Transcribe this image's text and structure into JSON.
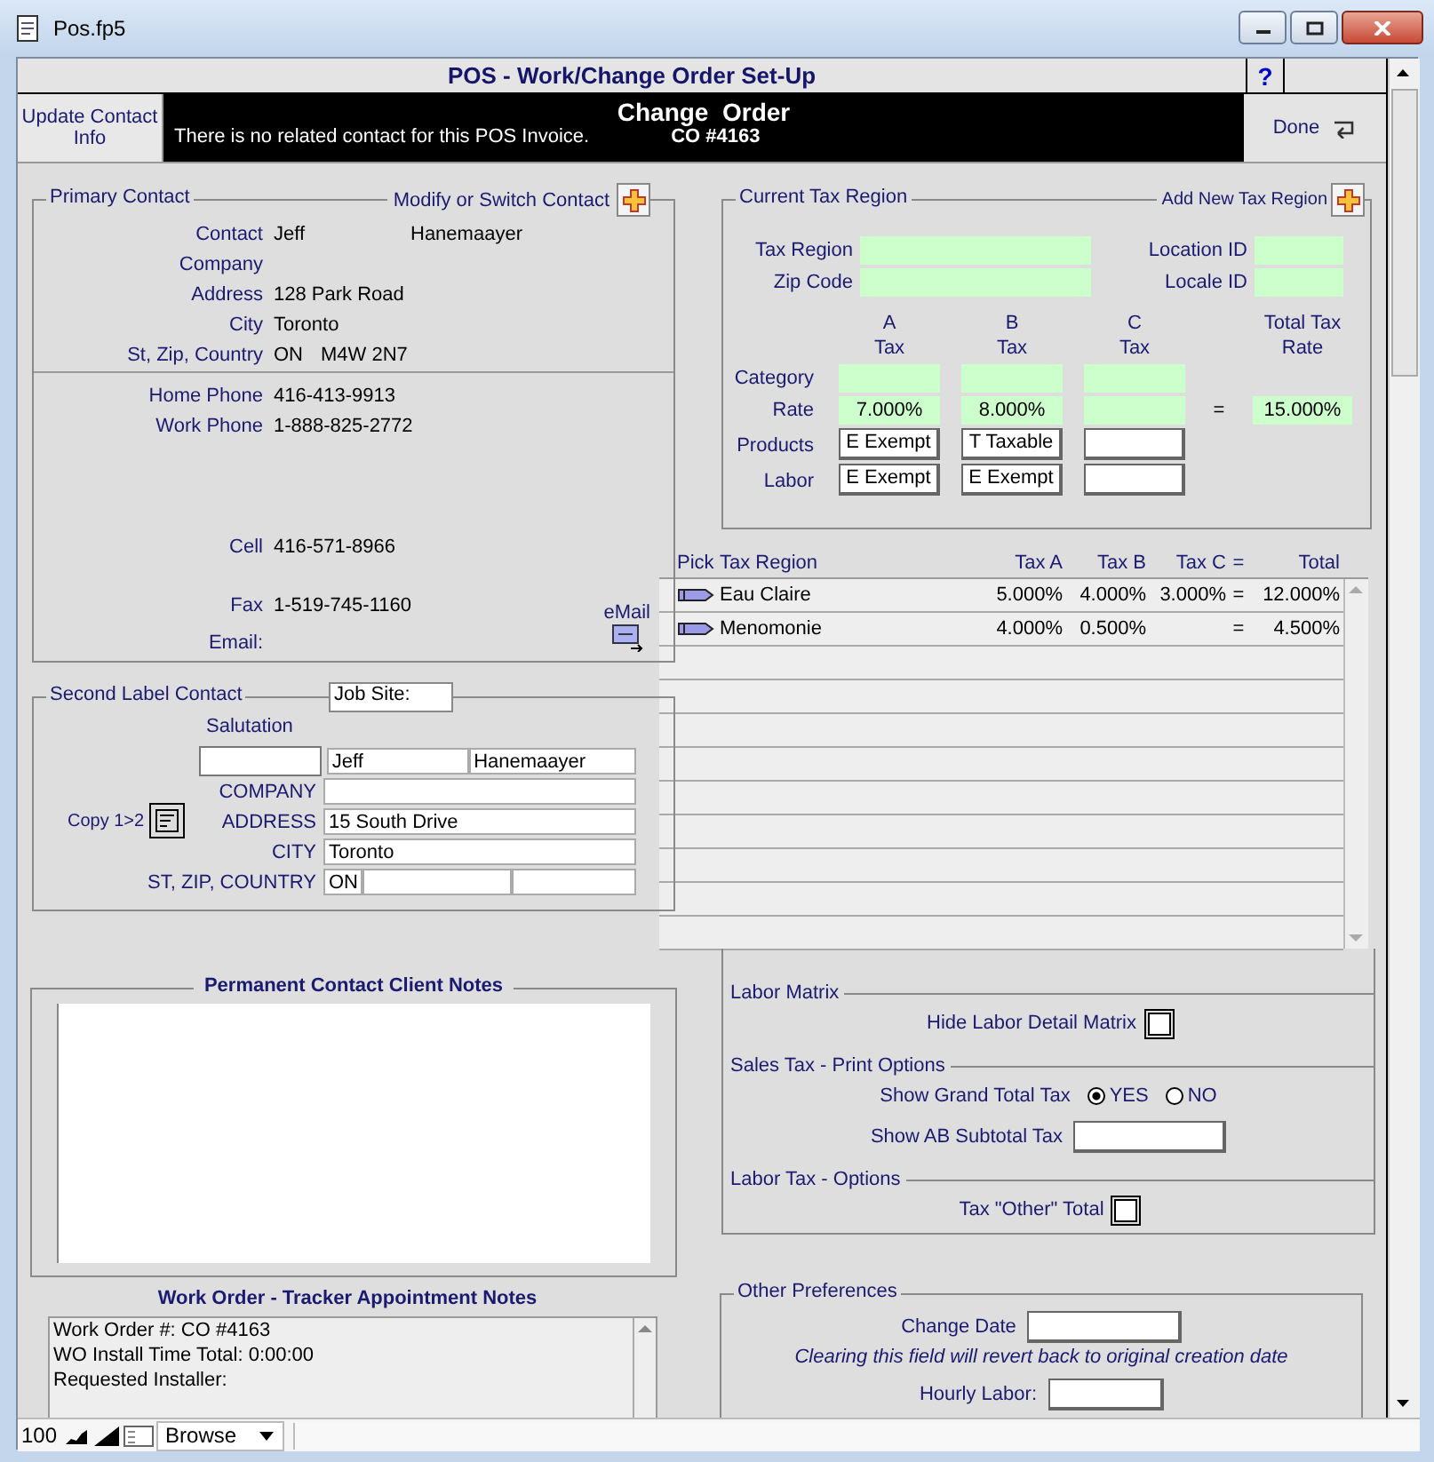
{
  "window": {
    "title": "Pos.fp5"
  },
  "header": {
    "title": "POS - Work/Change Order Set-Up",
    "help": "?",
    "update_button": "Update Contact Info",
    "heading": "Change  Order",
    "message": "There is no related contact for this POS Invoice.",
    "order_number": "CO #4163",
    "done_button": "Done"
  },
  "primary_contact": {
    "title": "Primary Contact",
    "modify_label": "Modify or Switch Contact",
    "fields": [
      {
        "label": "Contact",
        "values": [
          "Jeff",
          "Hanemaayer"
        ]
      },
      {
        "label": "Company"
      },
      {
        "label": "Address",
        "values": [
          "128 Park Road"
        ]
      },
      {
        "label": "City",
        "values": [
          "Toronto"
        ]
      },
      {
        "label": "St, Zip, Country",
        "values": [
          "ON",
          "M4W 2N7"
        ]
      }
    ],
    "phones": [
      {
        "label": "Home Phone",
        "value": "416-413-9913"
      },
      {
        "label": "Work Phone",
        "value": "1-888-825-2772"
      },
      {
        "label": "Cell",
        "value": "416-571-8966"
      },
      {
        "label": "Fax",
        "value": "1-519-745-1160"
      },
      {
        "label": "Email:"
      }
    ],
    "email_button": "eMail"
  },
  "second_contact": {
    "title": "Second Label Contact",
    "job_site": "Job Site:",
    "salutation_label": "Salutation",
    "first_name": "Jeff",
    "last_name": "Hanemaayer",
    "copy_label": "Copy 1>2",
    "rows": [
      {
        "kind": "single",
        "label": "COMPANY"
      },
      {
        "kind": "single",
        "label": "ADDRESS",
        "value": "15 South Drive"
      },
      {
        "kind": "single",
        "label": "CITY",
        "value": "Toronto"
      },
      {
        "kind": "triple",
        "label": "ST, ZIP, COUNTRY",
        "value": "ON"
      }
    ]
  },
  "client_notes": {
    "title": "Permanent Contact Client Notes"
  },
  "tracker_notes": {
    "title": "Work Order - Tracker Appointment Notes",
    "lines": [
      "Work Order #: CO #4163",
      "WO Install Time Total: 0:00:00",
      "Requested Installer:"
    ]
  },
  "tax_region": {
    "title": "Current Tax Region",
    "add_label": "Add New Tax Region",
    "region_label": "Tax Region",
    "zip_label": "Zip Code",
    "location_label": "Location ID",
    "locale_label": "Locale ID",
    "columns": [
      {
        "letter": "A",
        "heading": "Tax",
        "rate": "7.000%",
        "products": "E Exempt",
        "labor": "E Exempt"
      },
      {
        "letter": "B",
        "heading": "Tax",
        "rate": "8.000%",
        "products": "T Taxable",
        "labor": "E Exempt"
      },
      {
        "letter": "C",
        "heading": "Tax"
      }
    ],
    "category_label": "Category",
    "rate_label": "Rate",
    "products_label": "Products",
    "labor_label": "Labor",
    "equals": "=",
    "total_label": "Total Tax Rate",
    "total_rate": "15.000%"
  },
  "tax_table": {
    "columns": [
      "Pick",
      "Tax Region",
      "Tax A",
      "Tax B",
      "Tax C",
      "=",
      "Total"
    ],
    "rows": [
      {
        "region": "Eau Claire",
        "tax_a": "5.000%",
        "tax_b": "4.000%",
        "tax_c": "3.000%",
        "equals": "=",
        "total": "12.000%"
      },
      {
        "region": "Menomonie",
        "tax_a": "4.000%",
        "tax_b": "0.500%",
        "equals": "=",
        "total": "4.500%"
      }
    ]
  },
  "options": {
    "sections": [
      {
        "title": "Labor Matrix",
        "items": [
          {
            "kind": "checkbox",
            "label": "Hide Labor Detail Matrix",
            "checked": false
          }
        ]
      },
      {
        "title": "Sales Tax - Print Options",
        "items": [
          {
            "kind": "radio",
            "label": "Show Grand Total Tax",
            "options": [
              {
                "label": "YES",
                "selected": true
              },
              {
                "label": "NO",
                "selected": false
              }
            ]
          },
          {
            "kind": "field",
            "label": "Show AB Subtotal Tax"
          }
        ]
      },
      {
        "title": "Labor Tax  - Options",
        "items": [
          {
            "kind": "checkbox",
            "label": "Tax \"Other\" Total",
            "checked": false
          }
        ]
      }
    ]
  },
  "other_preferences": {
    "title": "Other Preferences",
    "change_date_label": "Change Date",
    "note": "Clearing this field will revert back to original creation date",
    "hourly_label": "Hourly Labor:"
  },
  "status_bar": {
    "zoom": "100",
    "mode": "Browse"
  }
}
